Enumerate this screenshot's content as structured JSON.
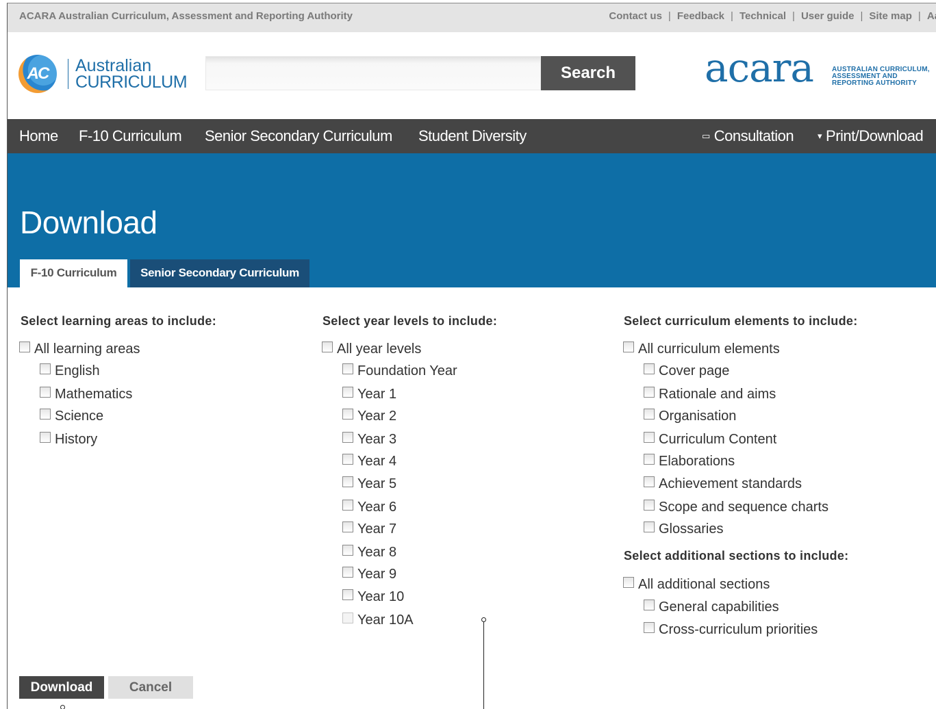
{
  "utility": {
    "org": "ACARA Australian Curriculum, Assessment and Reporting Authority",
    "links": [
      "Contact us",
      "Feedback",
      "Technical",
      "User guide",
      "Site map",
      "Aa"
    ]
  },
  "header": {
    "ac_logo": {
      "mark": "AC",
      "line1": "Australian",
      "line2": "CURRICULUM"
    },
    "search": {
      "value": "",
      "button_label": "Search"
    },
    "acara_logo": {
      "word": "acara",
      "tag_line1": "AUSTRALIAN CURRICULUM,",
      "tag_line2": "ASSESSMENT AND",
      "tag_line3": "REPORTING AUTHORITY"
    }
  },
  "nav": {
    "items": [
      "Home",
      "F-10 Curriculum",
      "Senior Secondary Curriculum",
      "Student Diversity"
    ],
    "right_items": [
      {
        "icon": "window-icon",
        "label": "Consultation"
      },
      {
        "icon": "arrow-down-icon",
        "label": "Print/Download"
      }
    ]
  },
  "page": {
    "title": "Download",
    "tabs": [
      "F-10 Curriculum",
      "Senior Secondary Curriculum"
    ],
    "active_tab": "F-10 Curriculum"
  },
  "learning_areas": {
    "heading": "Select learning areas to include:",
    "all_label": "All learning areas",
    "items": [
      "English",
      "Mathematics",
      "Science",
      "History"
    ]
  },
  "year_levels": {
    "heading": "Select year levels to include:",
    "all_label": "All year levels",
    "items": [
      "Foundation Year",
      "Year 1",
      "Year 2",
      "Year 3",
      "Year 4",
      "Year 5",
      "Year 6",
      "Year 7",
      "Year 8",
      "Year 9",
      "Year 10",
      "Year 10A"
    ]
  },
  "curriculum_elements": {
    "heading": "Select curriculum elements to include:",
    "all_label": "All curriculum elements",
    "items": [
      "Cover page",
      "Rationale and aims",
      "Organisation",
      "Curriculum Content",
      "Elaborations",
      "Achievement standards",
      "Scope and sequence charts",
      "Glossaries"
    ]
  },
  "additional_sections": {
    "heading": "Select additional sections to include:",
    "all_label": "All additional sections",
    "items": [
      "General capabilities",
      "Cross-curriculum priorities"
    ]
  },
  "actions": {
    "download_label": "Download",
    "cancel_label": "Cancel"
  },
  "colors": {
    "banner_blue": "#0e6ea6",
    "nav_grey": "#454545",
    "tab_inactive": "#1a4e78",
    "brand_blue": "#1f6fa8",
    "brand_orange": "#f39c33"
  }
}
